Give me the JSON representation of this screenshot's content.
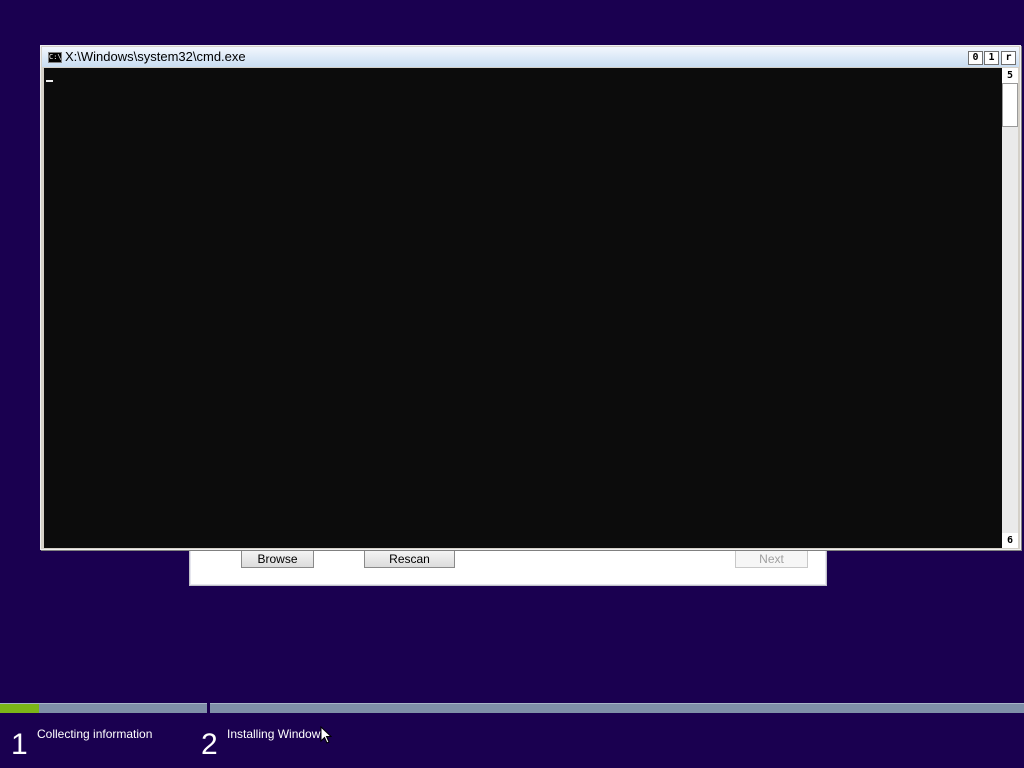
{
  "setup_dialog": {
    "browse_label": "Browse",
    "rescan_label": "Rescan",
    "next_label": "Next"
  },
  "cmd_window": {
    "title": "X:\\Windows\\system32\\cmd.exe",
    "icon_text": "C:\\",
    "controls": {
      "minimize": "0",
      "maximize": "1",
      "close": "r"
    },
    "scroll_up": "5",
    "scroll_down": "6"
  },
  "progress": {
    "step1_fill_fraction": 0.19,
    "steps": [
      {
        "number": "1",
        "label": "Collecting information"
      },
      {
        "number": "2",
        "label": "Installing Windows"
      }
    ]
  },
  "colors": {
    "background": "#1a0050",
    "progress_fill": "#7cb518",
    "progress_track": "#7f8fa8",
    "console_bg": "#0c0c0c"
  }
}
